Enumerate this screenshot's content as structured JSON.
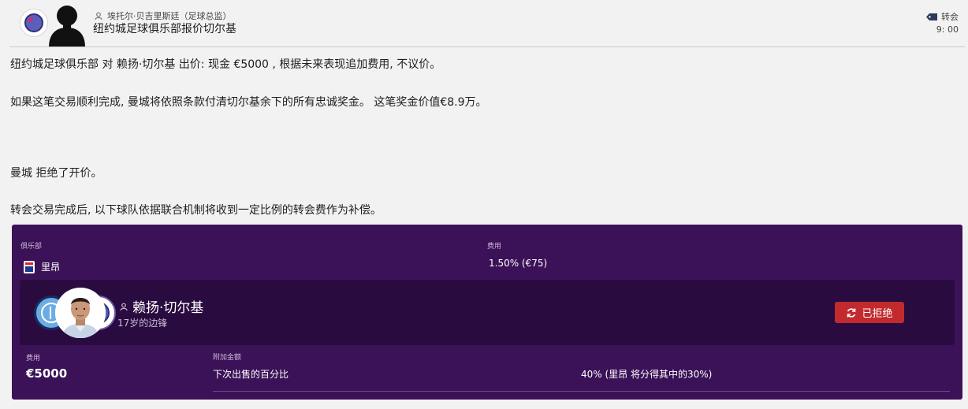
{
  "header": {
    "sender": "埃托尔·贝吉里斯廷（足球总监）",
    "subject": "纽约城足球俱乐部报价切尔基",
    "tag_label": "转会",
    "time": "9: 00"
  },
  "body": {
    "paragraph_1": "纽约城足球俱乐部 对 赖扬·切尔基 出价: 现金 €5000 , 根据未来表现追加费用, 不议价。",
    "paragraph_2": "如果这笔交易顺利完成, 曼城将依照条款付清切尔基余下的所有忠诚奖金。 这笔奖金价值€8.9万。",
    "paragraph_3": "曼城 拒绝了开价。",
    "paragraph_4": "转会交易完成后, 以下球队依据联合机制将收到一定比例的转会费作为补偿。"
  },
  "solidarity": {
    "club_header": "俱乐部",
    "fee_header": "费用",
    "club_name": "里昂",
    "fee_value": "1.50% (€75)"
  },
  "player": {
    "name": "赖扬·切尔基",
    "subtitle": "17岁的边锋",
    "status_button": "已拒绝"
  },
  "deal": {
    "fee_label": "费用",
    "fee_value": "€5000",
    "addons_label": "附加金额",
    "next_sale_label": "下次出售的百分比",
    "next_sale_value": "40% (里昂 将分得其中的30%)"
  },
  "colors": {
    "panel_bg": "#3b1257",
    "card_bg": "#2a0b40",
    "reject_red": "#c22a2e",
    "page_bg": "#f3f2f3"
  }
}
